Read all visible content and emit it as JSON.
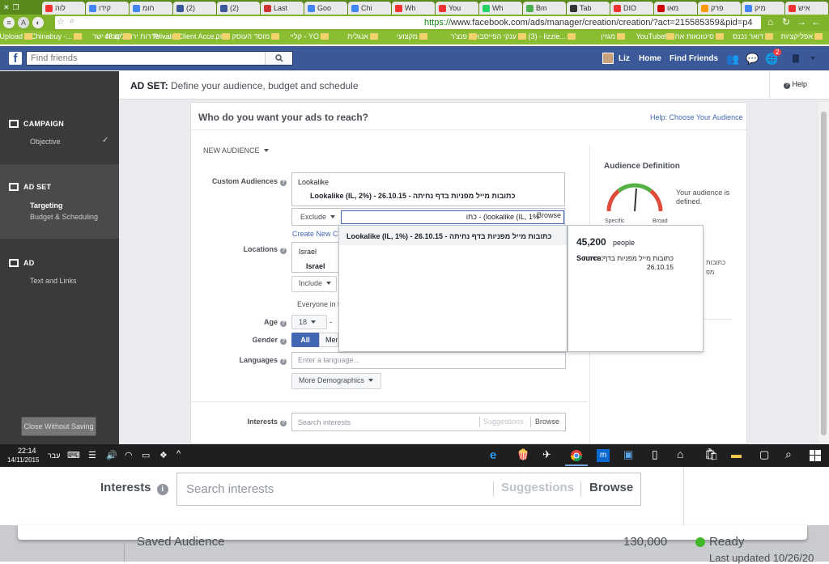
{
  "browser": {
    "tabs": [
      "איש",
      "מיק",
      "פרק",
      "מאו",
      "DIO",
      "Tab",
      "Bm",
      "Wh",
      "You",
      "Wh",
      "Chi",
      "Goo",
      "Last",
      "(2)",
      "(2)",
      "חומ",
      "קידו",
      "לוה"
    ],
    "url_scheme": "https://",
    "url_rest": "www.facebook.com/ads/manager/creation/creation/?act=215585359&pid=p4",
    "bookmarks": [
      "אפליקציות",
      "דואר נכנס",
      "סיטונאות אחרות",
      "YouTube",
      "מגזין",
      "(3) - lizzie...",
      "ענקי הפייסבוק",
      "פנצ'ר",
      "מקצועי",
      "אנגלית",
      "קליי - YO",
      "מוסד העוסק ביווק",
      "Private Client Acce...",
      "שדרות ירושלים 48 -...",
      "קונית ישר",
      "Chinabuy -...",
      "Upload"
    ]
  },
  "fb": {
    "search_placeholder": "Find friends",
    "user_name": "Liz",
    "home": "Home",
    "find_friends": "Find Friends",
    "notif_count": "2"
  },
  "sidebar": {
    "campaign": "CAMPAIGN",
    "objective": "Objective",
    "adset": "AD SET",
    "targeting": "Targeting",
    "budget": "Budget & Scheduling",
    "ad": "AD",
    "text_links": "Text and Links",
    "close": "Close Without Saving"
  },
  "header": {
    "prefix": "AD SET:",
    "title": "Define your audience, budget and schedule",
    "help": "Help"
  },
  "card": {
    "question": "Who do you want your ads to reach?",
    "help_link": "Help: Choose Your Audience",
    "new_audience": "NEW AUDIENCE",
    "custom_audiences_label": "Custom Audiences",
    "lookalike_heading": "Lookalike",
    "lookalike_selected": "Lookalike (IL, 2%) - 26.10.15 - כתובות מייל מפניות בדף נחיתה",
    "exclude_btn": "Exclude",
    "exclude_input": "כתו - (lookalike (IL, 1%",
    "browse_small": "Browse",
    "create_new": "Create New Cu",
    "locations_label": "Locations",
    "location_country": "Israel",
    "location_selected": "Israel",
    "include_btn": "Include",
    "everyone_in": "Everyone in th",
    "age_label": "Age",
    "age_from": "18",
    "gender_label": "Gender",
    "gender_all": "All",
    "gender_men": "Men",
    "languages_label": "Languages",
    "languages_placeholder": "Enter a language...",
    "more_demo": "More Demographics",
    "interests_label": "Interests",
    "interests_placeholder": "Search interests",
    "suggestions": "Suggestions",
    "browse": "Browse"
  },
  "dropdown": {
    "item": "Lookalike (IL, 1%) - 26.10.15 - כתובות מייל מפניות בדף נחיתה"
  },
  "popover": {
    "count": "45,200",
    "unit": "people",
    "source_label": "Source:",
    "source_value": "כתובות מייל מפניות בדף נחיתה - 26.10.15"
  },
  "audience_def": {
    "title": "Audience Definition",
    "specific": "Specific",
    "broad": "Broad",
    "defined_text": "Your audience is defined.",
    "right_rtl_1": "כתובות",
    "right_rtl_2": "מפ"
  },
  "taskbar": {
    "time": "22:14",
    "date": "14/11/2015",
    "lang": "עבר"
  },
  "zoom": {
    "interests_label": "Interests",
    "interests_placeholder": "Search interests",
    "suggestions": "Suggestions",
    "browse": "Browse",
    "saved_audience": "Saved Audience",
    "saved_value": "130,000",
    "ready": "Ready",
    "last_updated": "Last updated 10/26/20"
  },
  "colors": {
    "fb_blue": "#3b5998",
    "chrome_green": "#7fb32b",
    "sidebar": "#3a3a3a",
    "link": "#4267b2"
  }
}
